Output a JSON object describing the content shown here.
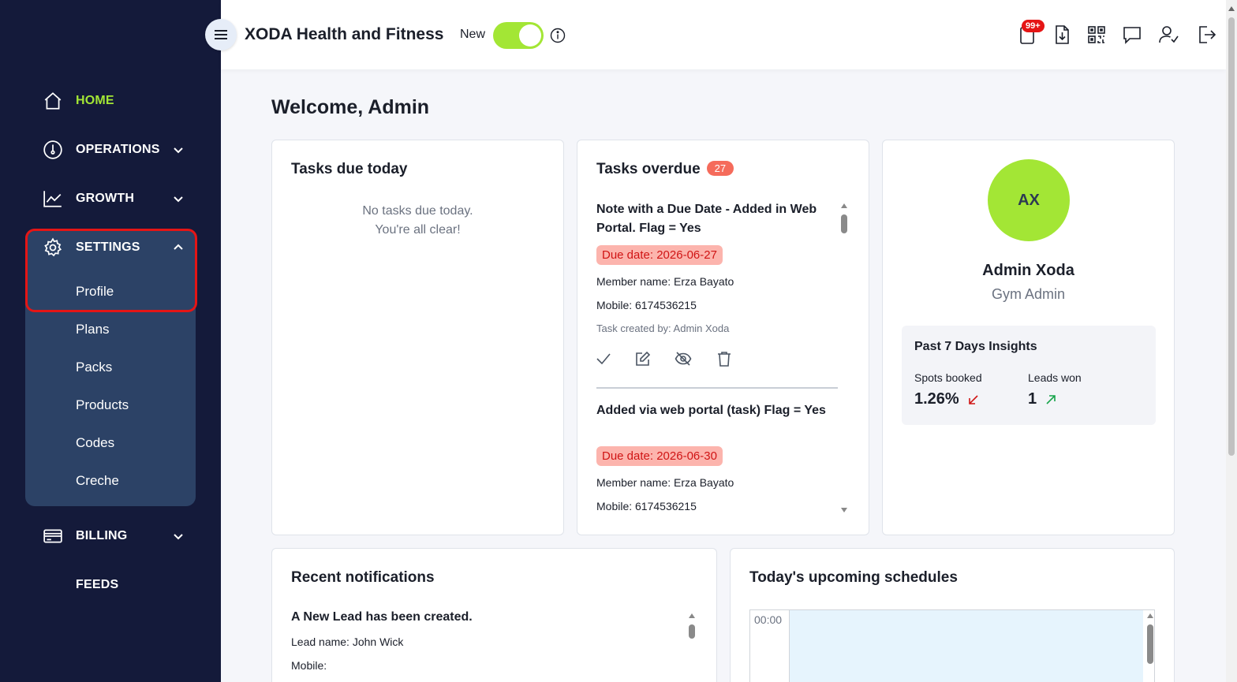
{
  "sidebar": {
    "items": [
      {
        "label": "HOME",
        "icon": "home-icon"
      },
      {
        "label": "OPERATIONS",
        "icon": "gauge-icon"
      },
      {
        "label": "GROWTH",
        "icon": "chart-line-icon"
      },
      {
        "label": "SETTINGS",
        "icon": "gear-icon"
      },
      {
        "label": "BILLING",
        "icon": "credit-card-icon"
      },
      {
        "label": "FEEDS"
      }
    ],
    "settings_submenu": [
      "Profile",
      "Plans",
      "Packs",
      "Products",
      "Codes",
      "Creche"
    ]
  },
  "header": {
    "title": "XODA Health and Fitness",
    "new_label": "New",
    "toggle_on": true,
    "notification_badge": "99+"
  },
  "main": {
    "welcome": "Welcome, Admin",
    "tasks_today": {
      "title": "Tasks due today",
      "empty_line1": "No tasks due today.",
      "empty_line2": "You're all clear!"
    },
    "tasks_overdue": {
      "title": "Tasks overdue",
      "count": "27",
      "tasks": [
        {
          "title": "Note with a Due Date - Added in Web Portal. Flag = Yes",
          "due": "Due date: 2026-06-27",
          "member": "Member name: Erza Bayato",
          "mobile": "Mobile: 6174536215",
          "creator": "Task created by: Admin Xoda"
        },
        {
          "title": "Added via web portal (task) Flag = Yes",
          "due": "Due date: 2026-06-30",
          "member": "Member name: Erza Bayato",
          "mobile": "Mobile: 6174536215"
        }
      ]
    },
    "profile": {
      "initials": "AX",
      "name": "Admin Xoda",
      "role": "Gym Admin",
      "insights_title": "Past 7 Days Insights",
      "spots_label": "Spots booked",
      "spots_value": "1.26%",
      "leads_label": "Leads won",
      "leads_value": "1"
    },
    "notifications": {
      "title": "Recent notifications",
      "item_title": "A New Lead has been created.",
      "lead_name": "Lead name: John Wick",
      "mobile": "Mobile:"
    },
    "schedules": {
      "title": "Today's upcoming schedules",
      "first_time": "00:00"
    }
  },
  "colors": {
    "sidebar_bg": "#141a3a",
    "submenu_bg": "#2c4266",
    "accent_green": "#a3e635",
    "alert_red": "#e51515",
    "due_bg": "#fcb4ad"
  }
}
